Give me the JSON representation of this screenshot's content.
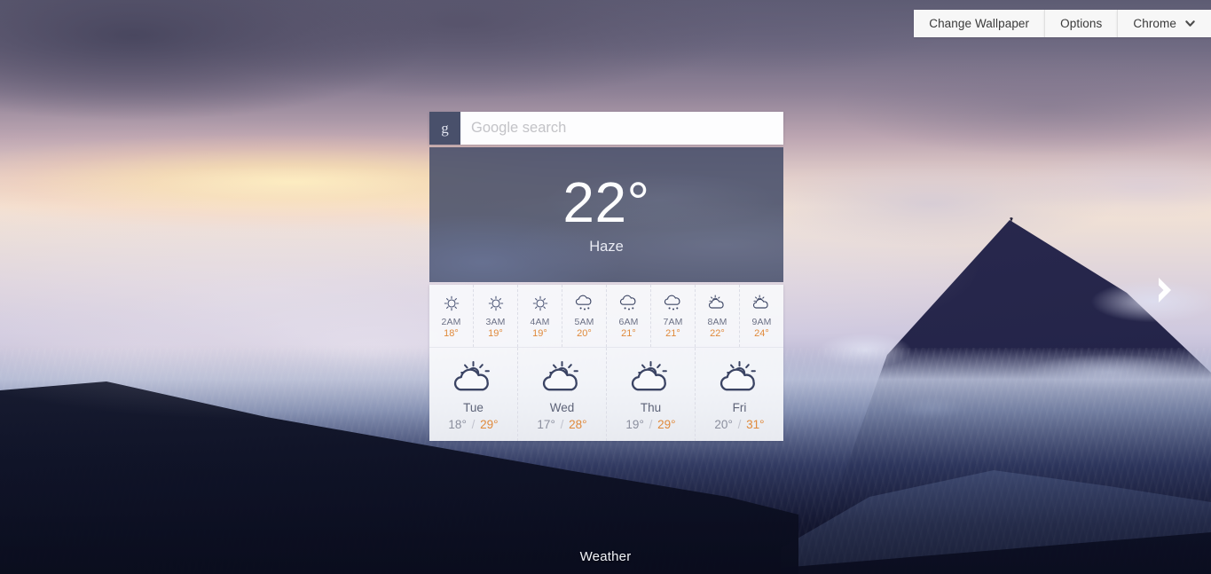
{
  "topbar": {
    "buttons": [
      {
        "label": "Change Wallpaper",
        "name": "change-wallpaper-button"
      },
      {
        "label": "Options",
        "name": "options-button"
      },
      {
        "label": "Chrome",
        "name": "chrome-menu-button",
        "icon": "chevron-down-icon"
      }
    ]
  },
  "search": {
    "icon": "google-g-icon",
    "glyph": "g",
    "value": "",
    "placeholder": "Google search"
  },
  "current": {
    "temperature": "22°",
    "condition": "Haze"
  },
  "hourly": [
    {
      "time": "2AM",
      "temp": "18°",
      "icon": "sun-icon"
    },
    {
      "time": "3AM",
      "temp": "19°",
      "icon": "sun-icon"
    },
    {
      "time": "4AM",
      "temp": "19°",
      "icon": "sun-icon"
    },
    {
      "time": "5AM",
      "temp": "20°",
      "icon": "rain-cloud-icon"
    },
    {
      "time": "6AM",
      "temp": "21°",
      "icon": "rain-cloud-icon"
    },
    {
      "time": "7AM",
      "temp": "21°",
      "icon": "rain-cloud-icon"
    },
    {
      "time": "8AM",
      "temp": "22°",
      "icon": "sun-behind-cloud-icon"
    },
    {
      "time": "9AM",
      "temp": "24°",
      "icon": "sun-behind-cloud-icon"
    }
  ],
  "daily": [
    {
      "day": "Tue",
      "low": "18°",
      "high": "29°",
      "separator": "/",
      "icon": "sun-behind-cloud-icon"
    },
    {
      "day": "Wed",
      "low": "17°",
      "high": "28°",
      "separator": "/",
      "icon": "sun-behind-cloud-icon"
    },
    {
      "day": "Thu",
      "low": "19°",
      "high": "29°",
      "separator": "/",
      "icon": "sun-behind-cloud-icon"
    },
    {
      "day": "Fri",
      "low": "20°",
      "high": "31°",
      "separator": "/",
      "icon": "sun-behind-cloud-icon"
    }
  ],
  "footer": {
    "label": "Weather"
  },
  "nav": {
    "next_icon": "chevron-right-icon"
  },
  "colors": {
    "high_temp": "#e08a3c",
    "low_temp": "#8b8f9e",
    "hour_temp": "#e08a3c",
    "panel_overlay": "#444c68",
    "icon_stroke": "#3c4463",
    "g_button": "#49506b"
  }
}
